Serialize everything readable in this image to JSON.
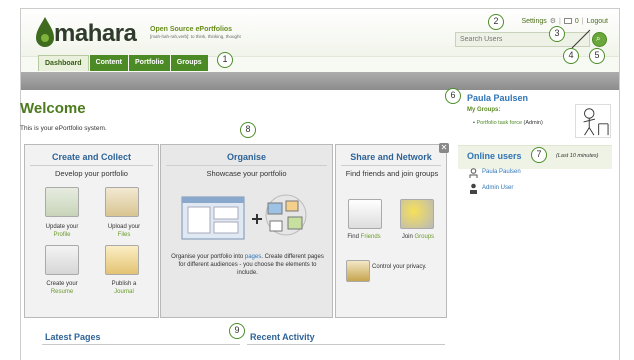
{
  "brand": {
    "name": "mahara",
    "tagline_title": "Open Source ePortfolios",
    "tagline_sub": "[mah-hah-rah,verb]: to think, thinking, thought"
  },
  "top_links": {
    "settings": "Settings",
    "mail_count": "0",
    "logout": "Logout"
  },
  "search": {
    "placeholder": "Search Users"
  },
  "nav": {
    "tabs": [
      "Dashboard",
      "Content",
      "Portfolio",
      "Groups"
    ],
    "active": "Dashboard"
  },
  "main": {
    "title": "Welcome",
    "intro": "This is your ePortfolio system."
  },
  "panels": {
    "create": {
      "title": "Create and Collect",
      "subtitle": "Develop your portfolio",
      "items": [
        {
          "pre": "Update your",
          "link": "Profile"
        },
        {
          "pre": "Upload your",
          "link": "Files"
        },
        {
          "pre": "Create your",
          "link": "Resume"
        },
        {
          "pre": "Publish a",
          "link": "Journal"
        }
      ]
    },
    "organise": {
      "title": "Organise",
      "subtitle": "Showcase your portfolio",
      "text_pre": "Organise your portfolio into",
      "text_link": "pages",
      "text_post": ". Create different pages for different audiences - you choose the elements to include."
    },
    "share": {
      "title": "Share and Network",
      "subtitle": "Find friends and join groups",
      "friends_pre": "Find",
      "friends_link": "Friends",
      "groups_pre": "Join",
      "groups_link": "Groups",
      "privacy": "Control your privacy."
    }
  },
  "sidebar": {
    "user_name": "Paula Paulsen",
    "my_groups_label": "My Groups:",
    "group_name": "Portfolio task force",
    "group_role": "(Admin)",
    "online_title": "Online users",
    "online_note": "(Last 10 minutes)",
    "online_users": [
      "Paula Paulsen",
      "Admin User"
    ]
  },
  "bottom": {
    "latest_pages": "Latest Pages",
    "recent_activity": "Recent Activity"
  },
  "callouts": [
    "1",
    "2",
    "3",
    "4",
    "5",
    "6",
    "7",
    "8",
    "9"
  ],
  "colors": {
    "nav_green": "#4c8a26",
    "heading_blue": "#2e6398",
    "welcome_green": "#4c7a1c",
    "callout_ring": "#4d8d2a"
  }
}
